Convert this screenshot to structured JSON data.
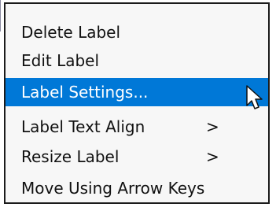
{
  "context_menu": {
    "items": [
      {
        "label": "Delete Label",
        "submenu_arrow": ""
      },
      {
        "label": "Edit Label",
        "submenu_arrow": ""
      },
      {
        "label": "Label Settings...",
        "submenu_arrow": ""
      },
      {
        "label": "Label Text Align",
        "submenu_arrow": ">"
      },
      {
        "label": "Resize Label",
        "submenu_arrow": ">"
      },
      {
        "label": "Move Using Arrow Keys",
        "submenu_arrow": ""
      }
    ],
    "selected_label": "Label Settings...",
    "colors": {
      "menu_background": "#f7f7f7",
      "highlight": "#0078d7",
      "border": "#1b1b1b",
      "text": "#111111"
    }
  },
  "cursor": {
    "icon": "arrow-pointer-icon"
  }
}
